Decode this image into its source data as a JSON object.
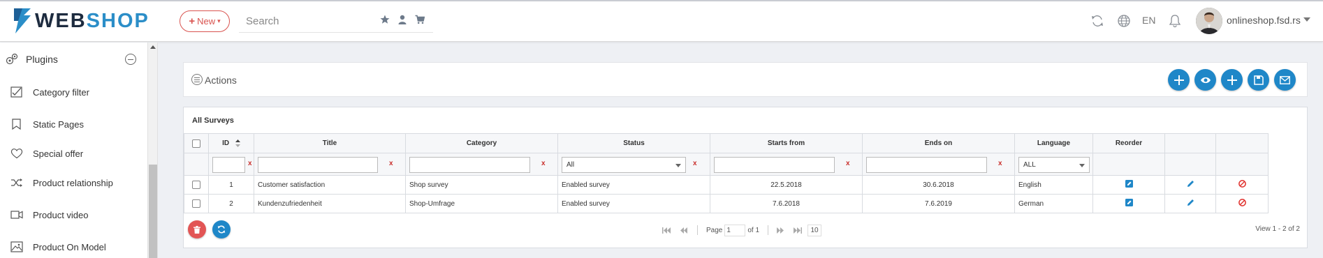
{
  "header": {
    "logo_web": "WEB",
    "logo_shop": "SHOP",
    "new_label": "New",
    "search_placeholder": "Search",
    "language": "EN",
    "user": "onlineshop.fsd.rs"
  },
  "sidebar": {
    "section_label": "Plugins",
    "items": [
      {
        "label": "Category filter",
        "icon": "checkbox-chart-icon"
      },
      {
        "label": "Static Pages",
        "icon": "bookmark-icon"
      },
      {
        "label": "Special offer",
        "icon": "heart-icon"
      },
      {
        "label": "Product relationship",
        "icon": "shuffle-icon"
      },
      {
        "label": "Product video",
        "icon": "video-icon"
      },
      {
        "label": "Product On Model",
        "icon": "image-icon"
      }
    ]
  },
  "actions": {
    "label": "Actions",
    "buttons": [
      "add-icon",
      "view-icon",
      "add-icon",
      "save-icon",
      "email-icon"
    ]
  },
  "grid": {
    "title": "All Surveys",
    "columns": [
      "ID",
      "Title",
      "Category",
      "Status",
      "Starts from",
      "Ends on",
      "Language",
      "Reorder"
    ],
    "filters": {
      "clear": "x",
      "status": "All",
      "language": "ALL"
    },
    "rows": [
      {
        "id": "1",
        "title": "Customer satisfaction",
        "category": "Shop survey",
        "status": "Enabled survey",
        "starts": "22.5.2018",
        "ends": "30.6.2018",
        "language": "English"
      },
      {
        "id": "2",
        "title": "Kundenzufriedenheit",
        "category": "Shop-Umfrage",
        "status": "Enabled survey",
        "starts": "7.6.2018",
        "ends": "7.6.2019",
        "language": "German"
      }
    ],
    "pager": {
      "page_label": "Page",
      "page": "1",
      "of_label": "of 1",
      "page_size": "10",
      "view_text": "View 1 - 2 of 2"
    }
  },
  "colors": {
    "accent": "#1f87c8",
    "danger": "#d9534f",
    "logo_dark": "#1d2b3f"
  }
}
